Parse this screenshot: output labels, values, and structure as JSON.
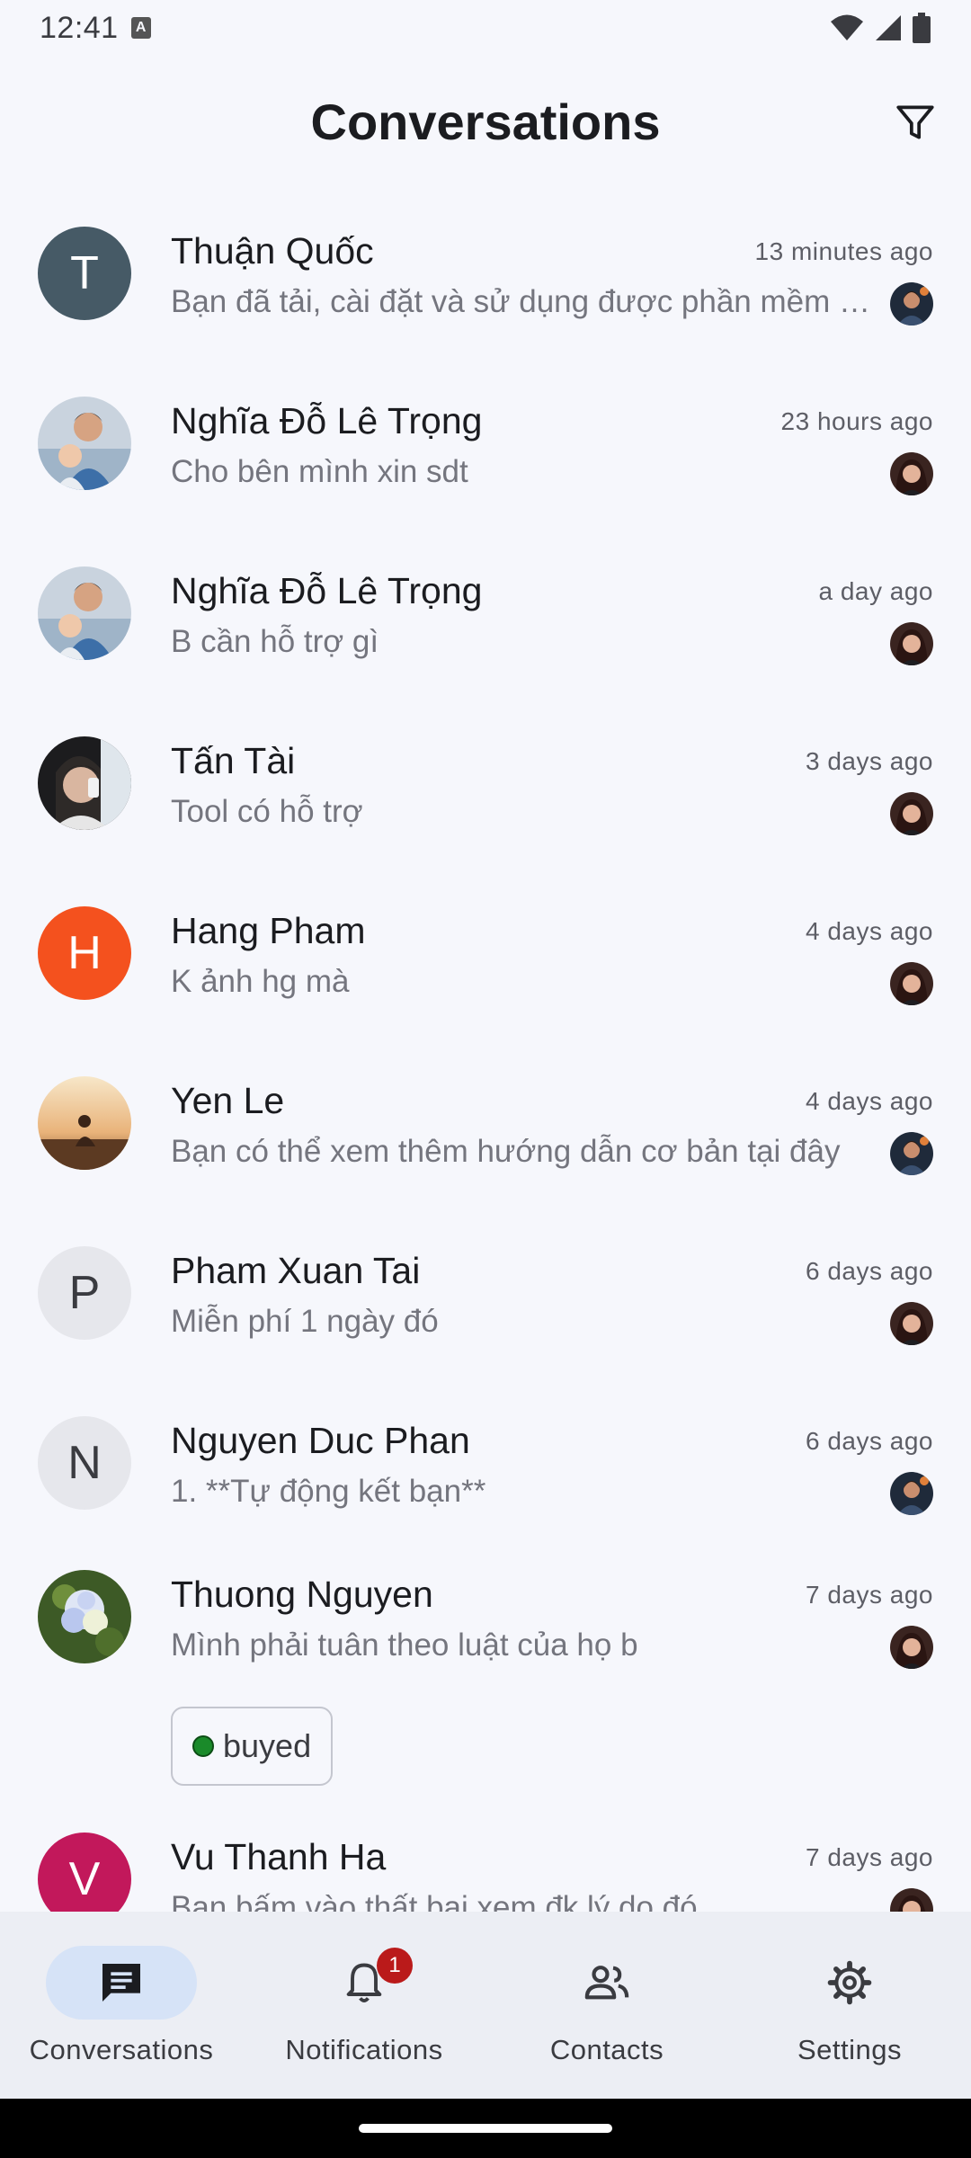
{
  "status_bar": {
    "time": "12:41",
    "notification_letter": "A"
  },
  "app_bar": {
    "title": "Conversations",
    "filter_icon": "filter-icon"
  },
  "conversations": [
    {
      "name": "Thuận Quốc",
      "time": "13 minutes ago",
      "preview": "Bạn đã tải, cài đặt và sử dụng được phần mềm chưa?",
      "avatar_letter": "T",
      "avatar_color": "#465a66"
    },
    {
      "name": "Nghĩa Đỗ Lê Trọng",
      "time": "23 hours ago",
      "preview": "Cho bên mình xin sdt"
    },
    {
      "name": "Nghĩa Đỗ Lê Trọng",
      "time": "a day ago",
      "preview": "B cần hỗ trợ gì"
    },
    {
      "name": "Tấn Tài",
      "time": "3 days ago",
      "preview": "Tool có hỗ trợ"
    },
    {
      "name": "Hang Pham",
      "time": "4 days ago",
      "preview": "K ảnh hg mà",
      "avatar_letter": "H",
      "avatar_color": "#f4511e"
    },
    {
      "name": "Yen Le",
      "time": "4 days ago",
      "preview": "Bạn có thể xem thêm hướng dẫn cơ bản tại đây"
    },
    {
      "name": "Pham Xuan Tai",
      "time": "6 days ago",
      "preview": "Miễn phí 1 ngày đó",
      "avatar_letter": "P",
      "avatar_color": "#e6e7ec"
    },
    {
      "name": "Nguyen Duc Phan",
      "time": "6 days ago",
      "preview": "1. **Tự động kết bạn**",
      "avatar_letter": "N",
      "avatar_color": "#e6e7ec"
    },
    {
      "name": "Thuong Nguyen",
      "time": "7 days ago",
      "preview": "Mình phải tuân theo luật của họ b",
      "tag": "buyed"
    },
    {
      "name": "Vu Thanh Ha",
      "time": "7 days ago",
      "preview": "Bạn bấm vào thất bại xem đk lý do đó",
      "avatar_letter": "V",
      "avatar_color": "#c2185b"
    }
  ],
  "bottom_nav": {
    "items": [
      {
        "label": "Conversations",
        "icon": "chat-icon",
        "active": true
      },
      {
        "label": "Notifications",
        "icon": "bell-icon",
        "badge": "1"
      },
      {
        "label": "Contacts",
        "icon": "people-icon"
      },
      {
        "label": "Settings",
        "icon": "gear-icon"
      }
    ]
  }
}
